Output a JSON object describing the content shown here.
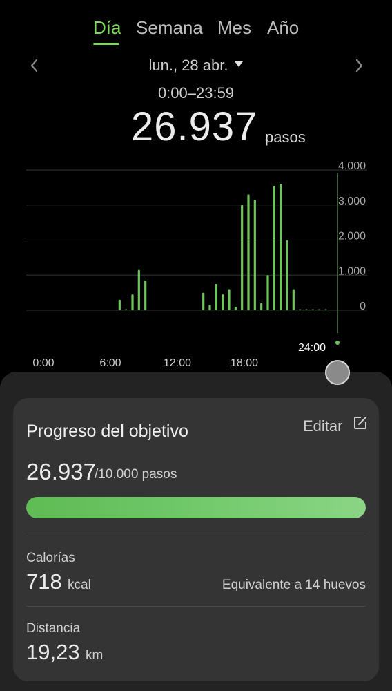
{
  "tabs": [
    {
      "label": "Día",
      "active": true
    },
    {
      "label": "Semana",
      "active": false
    },
    {
      "label": "Mes",
      "active": false
    },
    {
      "label": "Año",
      "active": false
    }
  ],
  "date": {
    "label": "lun., 28 abr.",
    "time_range": "0:00–23:59"
  },
  "steps": {
    "total": "26.937",
    "unit": "pasos"
  },
  "chart_data": {
    "type": "bar",
    "y_ticks": [
      "4.000",
      "3.000",
      "2.000",
      "1.000",
      "0"
    ],
    "ylim": [
      0,
      4000
    ],
    "x_ticks": [
      "0:00",
      "6:00",
      "12:00",
      "18:00"
    ],
    "cursor_label": "24:00",
    "grid": true,
    "series": [
      {
        "x_hours": [
          7.25,
          7.75,
          8.25,
          8.75,
          9.25,
          13.75,
          14.25,
          14.75,
          15.25,
          15.75,
          16.25,
          16.75,
          17.25,
          17.75,
          18.25,
          18.75,
          19.25,
          19.75,
          20.25,
          20.75,
          21.25,
          21.75,
          22.25,
          22.75,
          23.25
        ],
        "values": [
          300,
          30,
          450,
          1150,
          850,
          500,
          150,
          750,
          450,
          600,
          100,
          3000,
          3300,
          3150,
          200,
          1000,
          3550,
          3600,
          2000,
          600,
          30,
          20,
          10,
          30,
          30
        ],
        "color": "#6ec45a"
      }
    ]
  },
  "goal_card": {
    "title": "Progreso del objetivo",
    "edit_label": "Editar",
    "current": "26.937",
    "goal_text": "/10.000 pasos",
    "progress_fraction": 1.0,
    "calories_label": "Calorías",
    "calories_value": "718",
    "calories_unit": "kcal",
    "calories_equivalent": "Equivalente a 14 huevos",
    "distance_label": "Distancia",
    "distance_value": "19,23",
    "distance_unit": "km"
  },
  "colors": {
    "accent": "#7ed957",
    "bar": "#6ec45a",
    "background": "#000000",
    "card": "#343434"
  }
}
